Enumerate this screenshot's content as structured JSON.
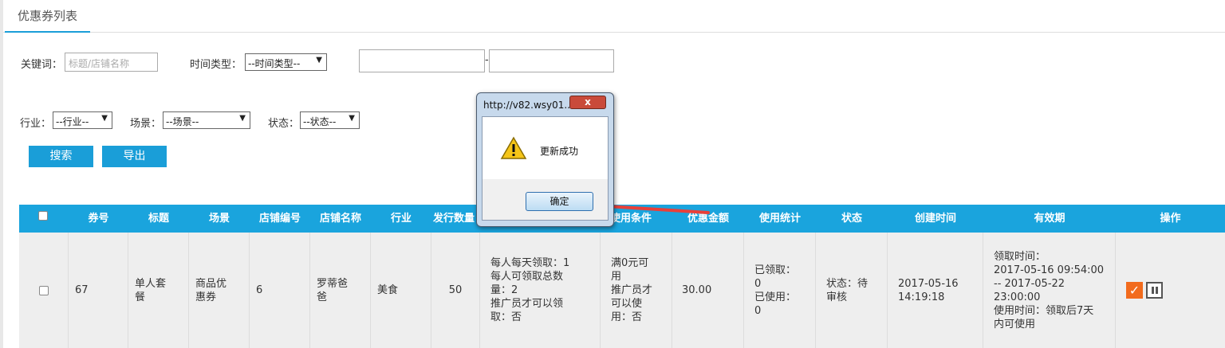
{
  "tabs": [
    {
      "label": "优惠券列表"
    }
  ],
  "filters": {
    "keyword_label": "关键词：",
    "keyword_placeholder": "标题/店铺名称",
    "time_type_label": "时间类型：",
    "time_type_value": "--时间类型--",
    "date_separator": "-",
    "industry_label": "行业：",
    "industry_value": "--行业--",
    "scene_label": "场景：",
    "scene_value": "--场景--",
    "status_label": "状态：",
    "status_value": "--状态--"
  },
  "buttons": {
    "search": "搜索",
    "export": "导出"
  },
  "table": {
    "headers": [
      "券号",
      "标题",
      "场景",
      "店铺编号",
      "店铺名称",
      "行业",
      "发行数量",
      "使用条件",
      "优惠金额",
      "使用统计",
      "状态",
      "创建时间",
      "有效期",
      "操作"
    ],
    "row": {
      "coupon_no": "67",
      "title": [
        "单人套",
        "餐"
      ],
      "scene": [
        "商品优",
        "惠券"
      ],
      "shop_no": "6",
      "shop_name": [
        "罗蒂爸",
        "爸"
      ],
      "industry": "美食",
      "quantity": "50",
      "rules": [
        "每人每天领取：1",
        "每人可领取总数",
        "量：2",
        "推广员才可以领",
        "取：否"
      ],
      "conditions": [
        "满0元可",
        "用",
        "推广员才",
        "可以使",
        "用：否"
      ],
      "amount": "30.00",
      "stats": [
        "已领取：",
        "0",
        "已使用：",
        "0"
      ],
      "status": [
        "状态：待",
        "审核"
      ],
      "created": [
        "2017-05-16",
        "14:19:18"
      ],
      "validity": [
        "领取时间：",
        "2017-05-16 09:54:00",
        "-- 2017-05-22",
        "23:00:00",
        "使用时间：领取后7天",
        "内可使用"
      ]
    }
  },
  "dialog": {
    "title": "http://v82.wsy01...",
    "close": "x",
    "message": "更新成功",
    "ok": "确定"
  },
  "colors": {
    "accent": "#1aa4dd",
    "edit": "#f26b1d",
    "arrow": "#e8403a"
  }
}
